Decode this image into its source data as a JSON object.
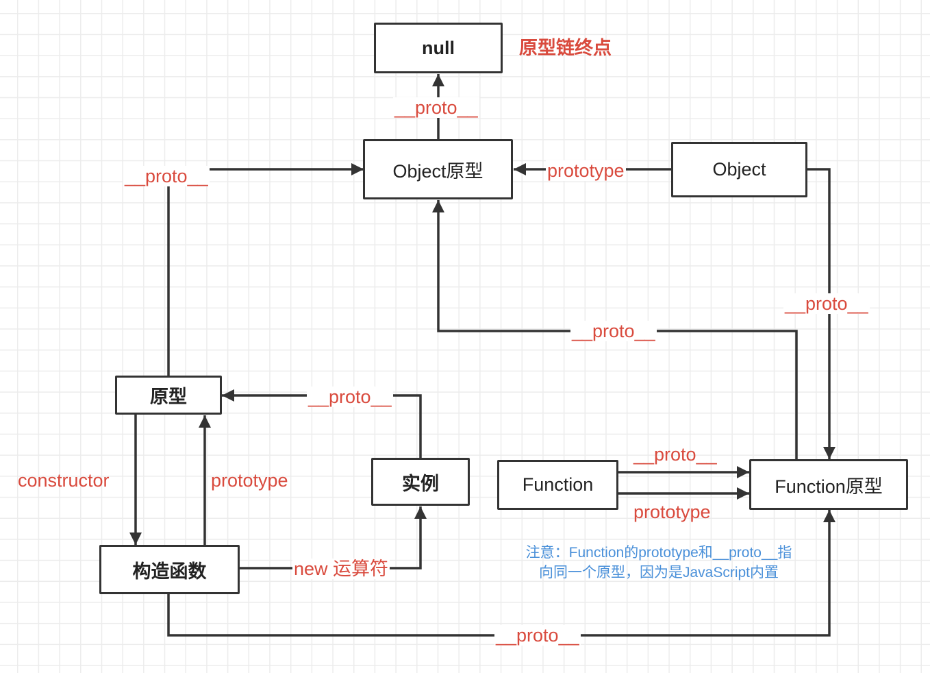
{
  "nodes": {
    "null": "null",
    "object_prototype": "Object原型",
    "object": "Object",
    "prototype": "原型",
    "instance": "实例",
    "constructor": "构造函数",
    "function": "Function",
    "function_prototype": "Function原型"
  },
  "labels": {
    "chain_end": "原型链终点",
    "objproto_to_null": "__proto__",
    "object_prototype_link": "prototype",
    "proto_to_objproto": "__proto__",
    "object_proto": "__proto__",
    "funcproto_to_objproto": "__proto__",
    "instance_proto": "__proto__",
    "constructor_link": "constructor",
    "prototype_link": "prototype",
    "new_operator": "new 运算符",
    "function_proto": "__proto__",
    "function_prototype_link": "prototype",
    "ctor_proto": "__proto__"
  },
  "note": {
    "line1": "注意：Function的prototype和__proto__指",
    "line2": "向同一个原型，因为是JavaScript内置"
  },
  "colors": {
    "line": "#333333",
    "label_red": "#d94a3d",
    "note_blue": "#4a90d9"
  }
}
